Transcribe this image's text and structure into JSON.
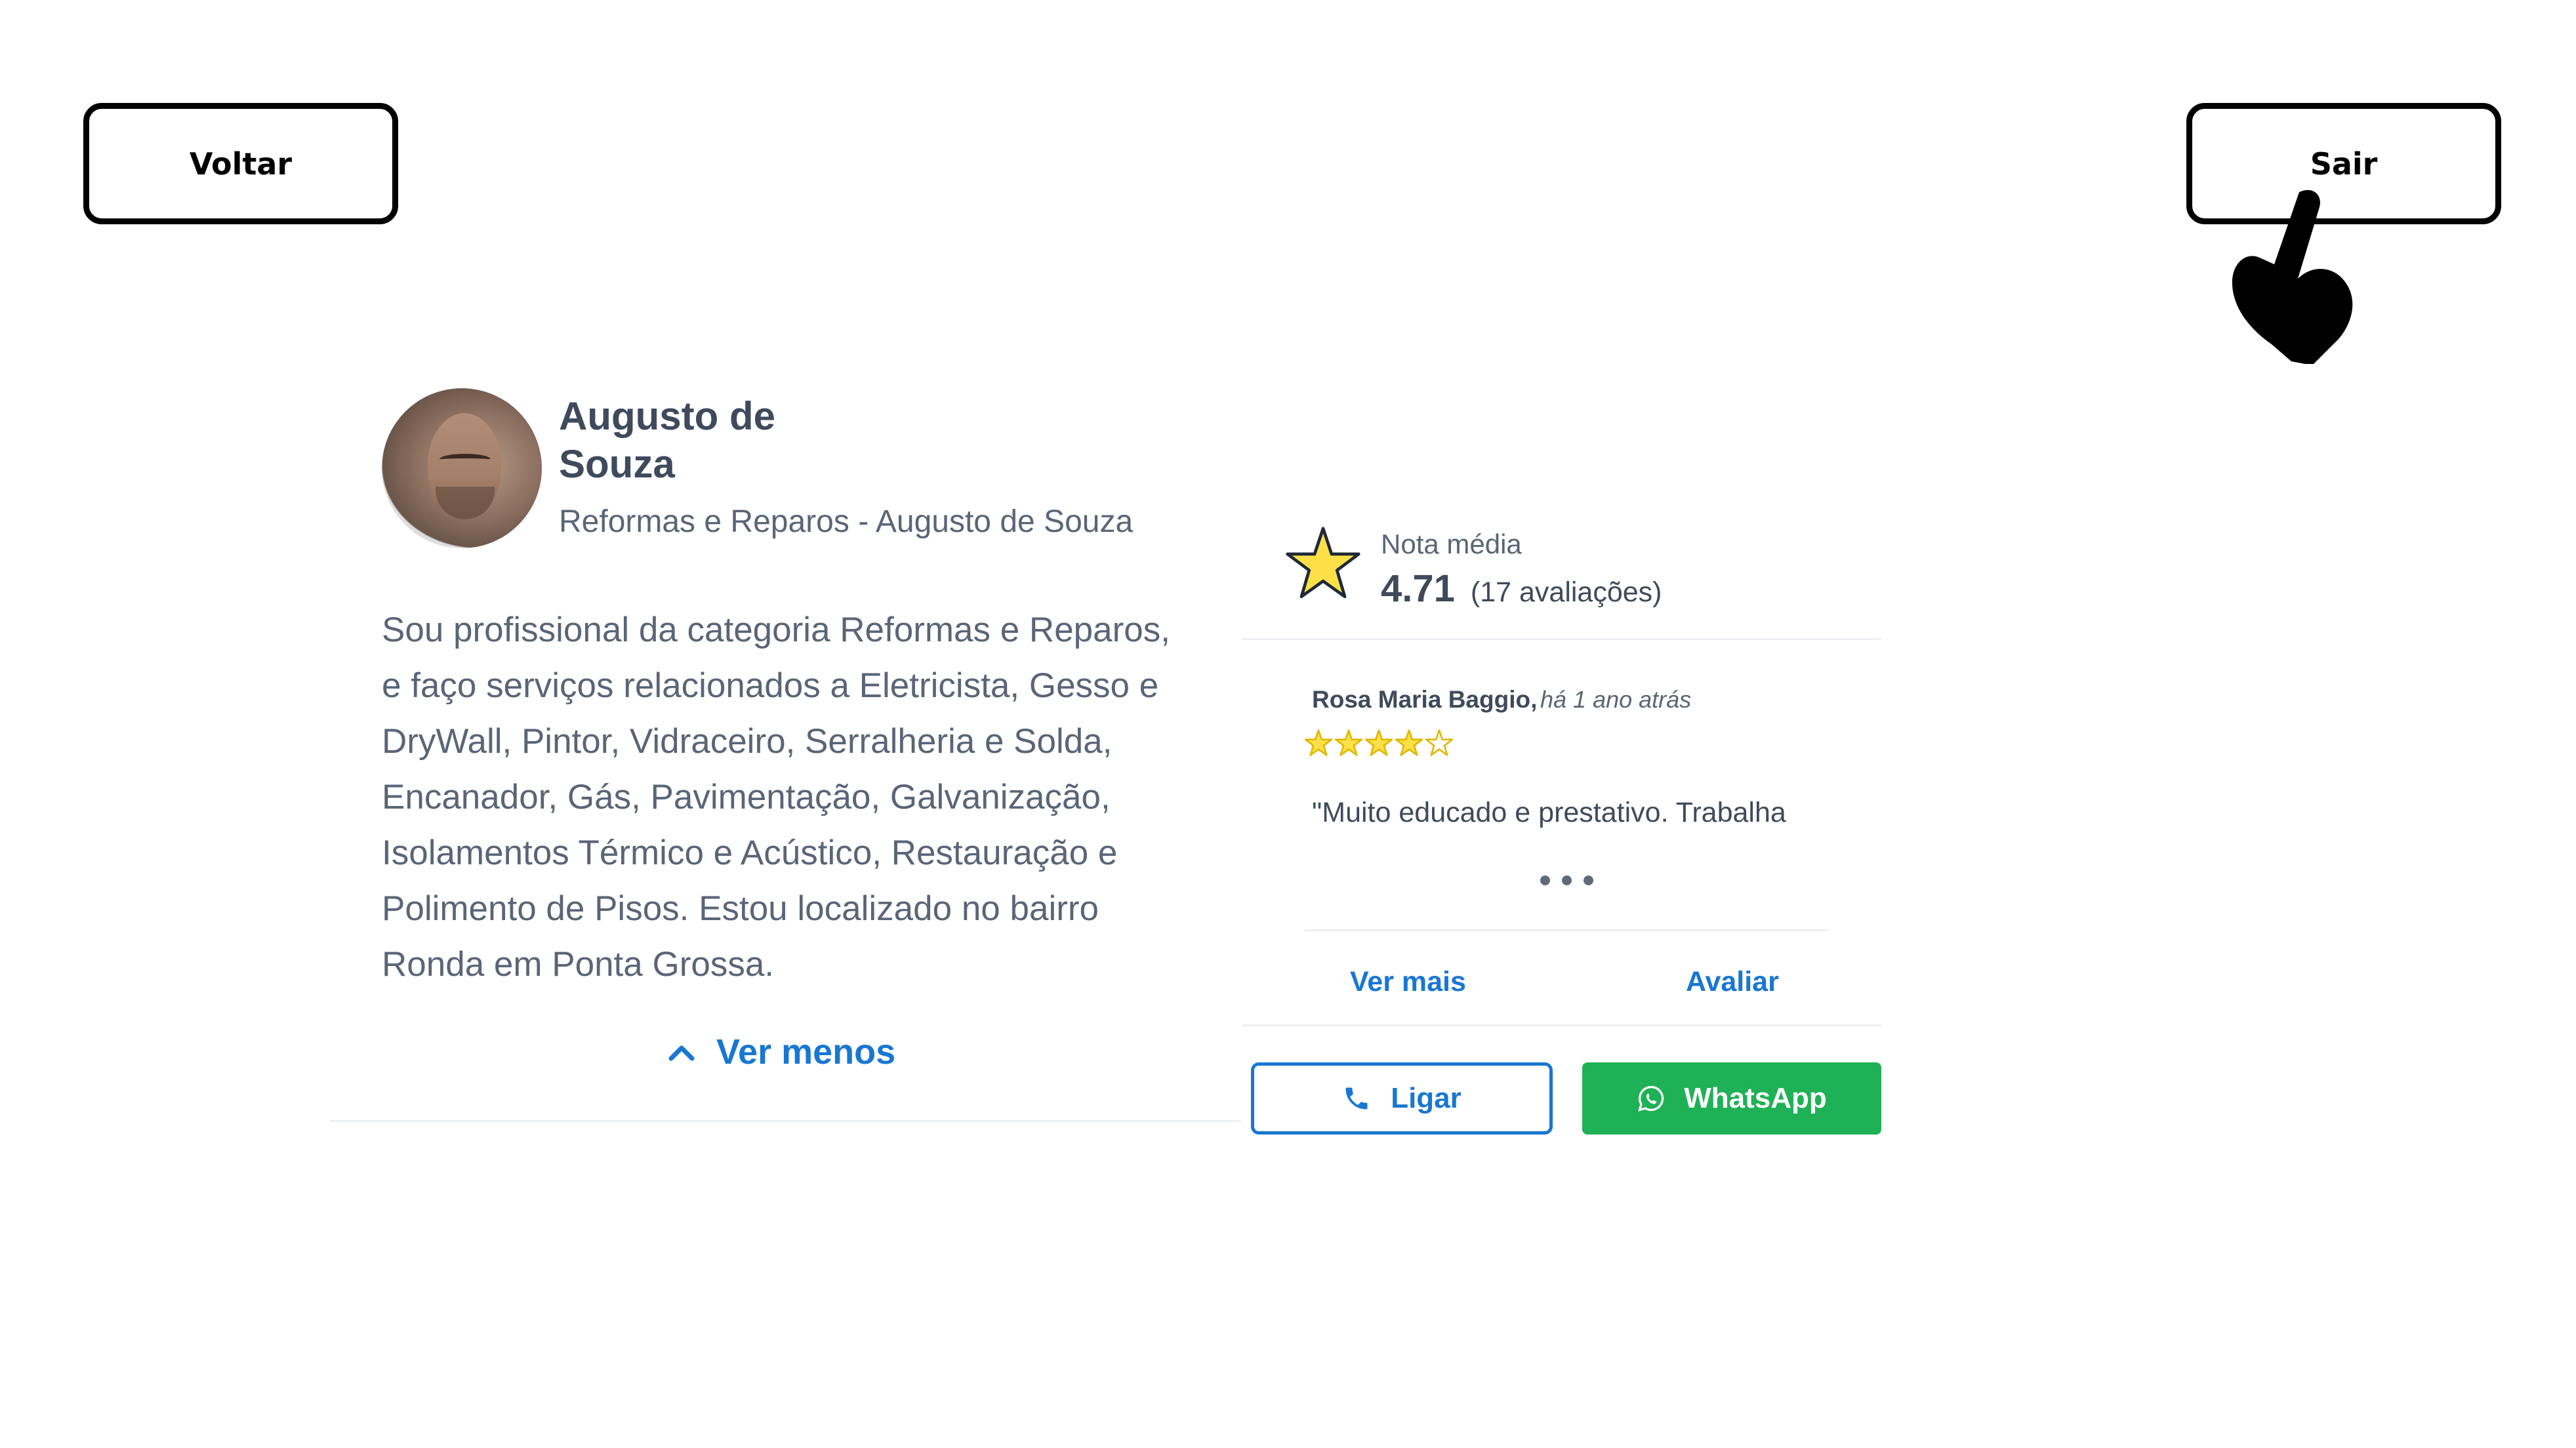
{
  "nav": {
    "back_label": "Voltar",
    "exit_label": "Sair"
  },
  "profile": {
    "name": "Augusto de Souza",
    "subtitle": "Reformas e Reparos - Augusto de Souza",
    "bio": "Sou profissional da categoria Reformas e Reparos, e faço serviços relacionados a Eletricista, Gesso e DryWall, Pintor, Vidraceiro, Serralheria e Solda, Encanador, Gás, Pavimentação, Galvanização, Isolamentos Térmico e Acústico, Restauração e Polimento de Pisos. Estou localizado no bairro Ronda em Ponta Grossa.",
    "toggle_label": "Ver menos"
  },
  "rating": {
    "label": "Nota média",
    "value": "4.71",
    "count_text": "(17 avaliações)"
  },
  "review": {
    "author": "Rosa Maria Baggio,",
    "time": "há 1 ano atrás",
    "stars": 4,
    "max_stars": 5,
    "text": "\"Muito educado e prestativo. Trabalha"
  },
  "actions": {
    "see_more_label": "Ver mais",
    "rate_label": "Avaliar",
    "call_label": "Ligar",
    "whatsapp_label": "WhatsApp"
  },
  "colors": {
    "accent": "#1877d2",
    "whatsapp": "#1fb155",
    "star": "#fde047",
    "text": "#3f4a5c"
  }
}
